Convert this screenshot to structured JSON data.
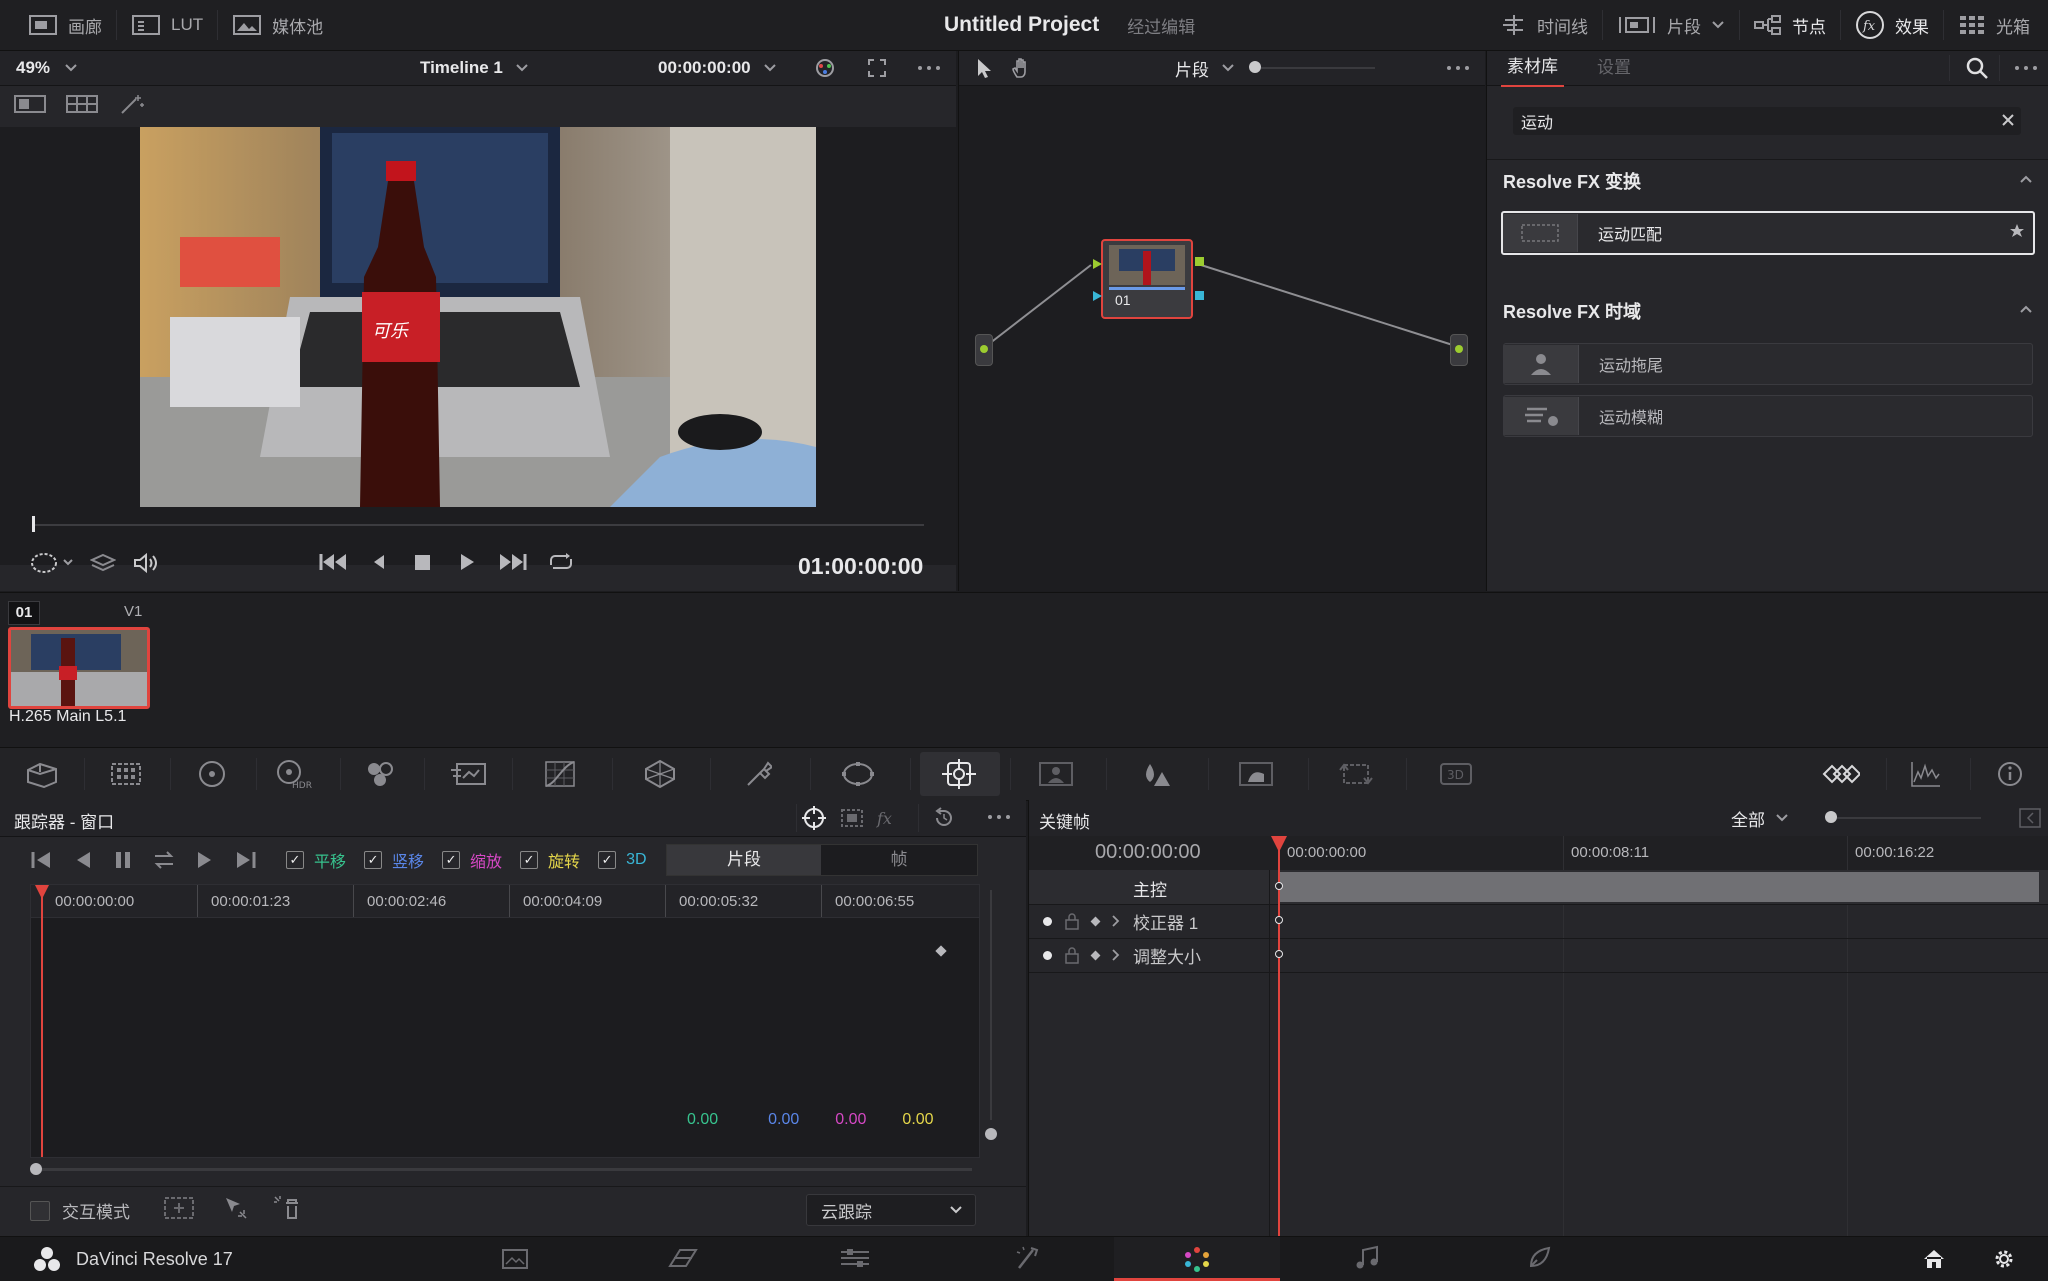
{
  "topbar": {
    "gallery": "画廊",
    "lut": "LUT",
    "media_pool": "媒体池",
    "project_title": "Untitled Project",
    "edited": "经过编辑",
    "timeline": "时间线",
    "clips": "片段",
    "nodes": "节点",
    "effects": "效果",
    "lightbox": "光箱"
  },
  "viewer": {
    "zoom": "49%",
    "timeline_name": "Timeline 1",
    "timecode": "00:00:00:00",
    "playhead_timecode": "01:00:00:00"
  },
  "nodes": {
    "mode_label": "片段",
    "node_label": "01"
  },
  "library": {
    "tab_library": "素材库",
    "tab_settings": "设置",
    "search_value": "运动",
    "group1_title": "Resolve FX 变换",
    "group1_items": [
      "运动匹配"
    ],
    "group2_title": "Resolve FX 时域",
    "group2_items": [
      "运动拖尾",
      "运动模糊"
    ]
  },
  "clips": {
    "clip_number": "01",
    "track": "V1",
    "codec": "H.265 Main L5.1"
  },
  "tracker": {
    "title": "跟踪器 - 窗口",
    "pan": "平移",
    "tilt": "竖移",
    "zoom": "缩放",
    "rotate": "旋转",
    "three_d": "3D",
    "seg_clip": "片段",
    "seg_frame": "帧",
    "ticks": [
      "00:00:00:00",
      "00:00:01:23",
      "00:00:02:46",
      "00:00:04:09",
      "00:00:05:32",
      "00:00:06:55"
    ],
    "values": [
      "0.00",
      "0.00",
      "0.00",
      "0.00"
    ],
    "interactive_mode": "交互模式",
    "cloud_tracker": "云跟踪"
  },
  "keyframes": {
    "title": "关键帧",
    "filter": "全部",
    "timecode": "00:00:00:00",
    "ticks": [
      "00:00:00:00",
      "00:00:08:11",
      "00:00:16:22"
    ],
    "master": "主控",
    "rows": [
      "校正器 1",
      "调整大小"
    ]
  },
  "footer": {
    "app_name": "DaVinci Resolve 17"
  },
  "colors": {
    "accent_red": "#e0443e",
    "pan_green": "#37c38e",
    "tilt_blue": "#5a86e8",
    "zoom_pink": "#d548c4",
    "rotate_yellow": "#e4d64a",
    "threed_cyan": "#39b6d6"
  }
}
